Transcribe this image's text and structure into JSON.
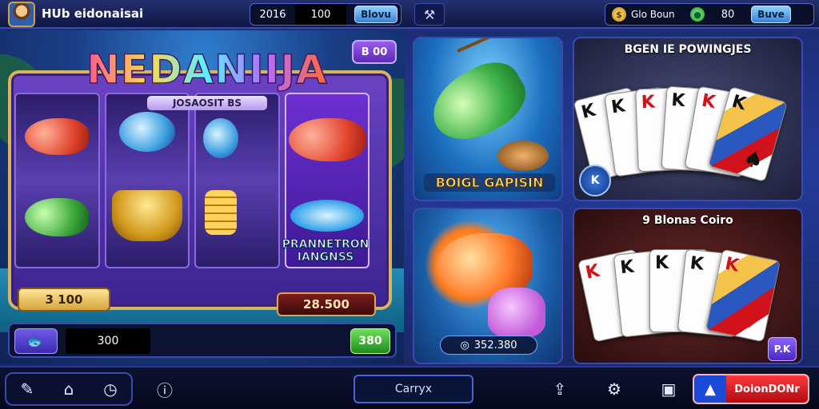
{
  "topbar": {
    "app_title": "HUb eidonaisai",
    "left_value_1": "2016",
    "left_value_2": "100",
    "left_button": "Blovu",
    "right_label": "Glo Boun",
    "right_value": "80",
    "right_button": "Buve"
  },
  "slot": {
    "logo": "NEDANIIJA",
    "logo_sub": "JOSAOSIT BS",
    "bet_pill": "B 00",
    "promo_text": "PRANNETRON IANGNSS",
    "left_plate": "3 100",
    "right_plate": "28.500",
    "amount_field": "300",
    "spin_button": "380"
  },
  "tiles": {
    "fishing_caption": "BOIGL GAPISIN",
    "poker1_title": "BGEN IE POWINGJES",
    "poker1_badge": "K",
    "fire_amount": "352.380",
    "poker2_title": "9 Blonas Coiro",
    "poker2_badge": "P.K"
  },
  "cards": {
    "poker1": [
      {
        "rank": "K",
        "suit": "♠",
        "red": false
      },
      {
        "rank": "K",
        "suit": "♣",
        "red": false
      },
      {
        "rank": "K",
        "suit": "♥",
        "red": true
      },
      {
        "rank": "K",
        "suit": "♠",
        "red": false
      },
      {
        "rank": "K",
        "suit": "♥",
        "red": true
      },
      {
        "rank": "K",
        "suit": "♠",
        "red": false
      }
    ],
    "poker2": [
      {
        "rank": "K",
        "suit": "♥",
        "red": true
      },
      {
        "rank": "K",
        "suit": "♣",
        "red": false
      },
      {
        "rank": "K",
        "suit": "♠",
        "red": false
      },
      {
        "rank": "K",
        "suit": "♠",
        "red": false
      },
      {
        "rank": "K",
        "suit": "♥",
        "red": true
      }
    ]
  },
  "bottombar": {
    "center_button": "Carryx",
    "download_button": "DoionDONr"
  },
  "colors": {
    "accent_blue": "#3b82d6",
    "accent_gold": "#d8b45a",
    "download_red": "#d11a22",
    "spin_green": "#1f8a1a"
  },
  "icons": [
    "avatar",
    "tool-icon",
    "gold-coin-icon",
    "green-coin-icon",
    "fish-icon",
    "edit-icon",
    "home-icon",
    "clock-icon",
    "info-icon",
    "share-icon",
    "settings-icon",
    "wallet-icon",
    "app-icon"
  ]
}
